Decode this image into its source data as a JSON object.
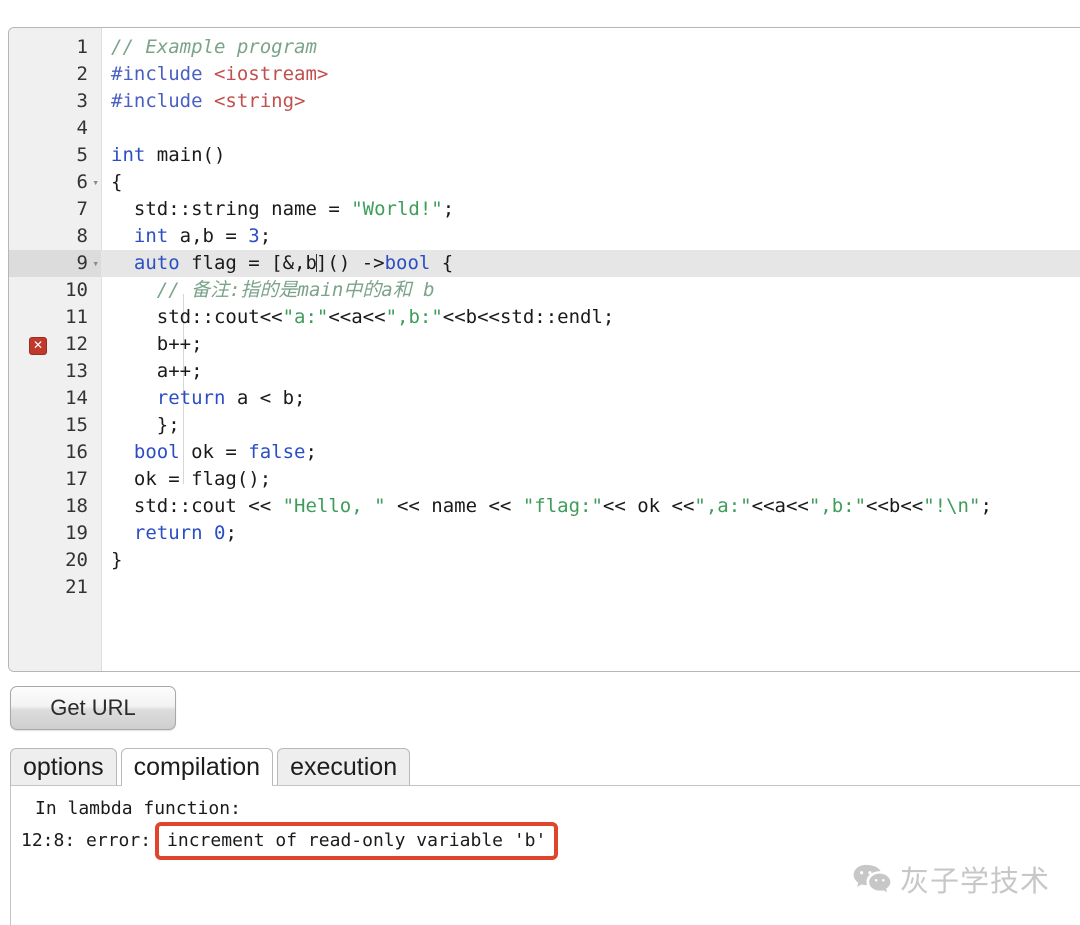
{
  "editor": {
    "name": "cpp-code-editor",
    "active_line": 9,
    "error_line": 12,
    "error_marker_glyph": "✕",
    "fold_lines": [
      6,
      9
    ],
    "colors": {
      "comment": "#7aa38a",
      "preprocessor": "#4a5fc1",
      "header": "#c0504d",
      "keyword": "#2b4ec4",
      "string": "#3f9d5a",
      "plain": "#1a1a1a",
      "gutter_bg": "#f0f0f0",
      "active_line_bg": "#e6e6e6",
      "error_marker": "#c0392b"
    },
    "lines": [
      {
        "n": "1",
        "tokens": [
          {
            "c": "t-com",
            "t": "// Example program"
          }
        ]
      },
      {
        "n": "2",
        "tokens": [
          {
            "c": "t-pre",
            "t": "#include"
          },
          {
            "c": "t-pln",
            "t": " "
          },
          {
            "c": "t-hdr",
            "t": "<iostream>"
          }
        ]
      },
      {
        "n": "3",
        "tokens": [
          {
            "c": "t-pre",
            "t": "#include"
          },
          {
            "c": "t-pln",
            "t": " "
          },
          {
            "c": "t-hdr",
            "t": "<string>"
          }
        ]
      },
      {
        "n": "4",
        "tokens": []
      },
      {
        "n": "5",
        "tokens": [
          {
            "c": "t-kw",
            "t": "int"
          },
          {
            "c": "t-pln",
            "t": " main()"
          }
        ]
      },
      {
        "n": "6",
        "tokens": [
          {
            "c": "t-pln",
            "t": "{"
          }
        ]
      },
      {
        "n": "7",
        "tokens": [
          {
            "c": "t-pln",
            "t": "  std::string name = "
          },
          {
            "c": "t-str",
            "t": "\"World!\""
          },
          {
            "c": "t-pln",
            "t": ";"
          }
        ]
      },
      {
        "n": "8",
        "tokens": [
          {
            "c": "t-pln",
            "t": "  "
          },
          {
            "c": "t-kw",
            "t": "int"
          },
          {
            "c": "t-pln",
            "t": " a,b = "
          },
          {
            "c": "t-num",
            "t": "3"
          },
          {
            "c": "t-pln",
            "t": ";"
          }
        ]
      },
      {
        "n": "9",
        "tokens": [
          {
            "c": "t-pln",
            "t": "  "
          },
          {
            "c": "t-kw",
            "t": "auto"
          },
          {
            "c": "t-pln",
            "t": " flag = [&,b]() ->"
          },
          {
            "c": "t-kw",
            "t": "bool"
          },
          {
            "c": "t-pln",
            "t": " {"
          }
        ]
      },
      {
        "n": "10",
        "tokens": [
          {
            "c": "t-pln",
            "t": "    "
          },
          {
            "c": "t-com",
            "t": "// 备注:指的是main中的a和 b"
          }
        ]
      },
      {
        "n": "11",
        "tokens": [
          {
            "c": "t-pln",
            "t": "    std::cout<<"
          },
          {
            "c": "t-str",
            "t": "\"a:\""
          },
          {
            "c": "t-pln",
            "t": "<<a<<"
          },
          {
            "c": "t-str",
            "t": "\",b:\""
          },
          {
            "c": "t-pln",
            "t": "<<b<<std::endl;"
          }
        ]
      },
      {
        "n": "12",
        "tokens": [
          {
            "c": "t-pln",
            "t": "    b++;"
          }
        ]
      },
      {
        "n": "13",
        "tokens": [
          {
            "c": "t-pln",
            "t": "    a++;"
          }
        ]
      },
      {
        "n": "14",
        "tokens": [
          {
            "c": "t-pln",
            "t": "    "
          },
          {
            "c": "t-kw",
            "t": "return"
          },
          {
            "c": "t-pln",
            "t": " a < b;"
          }
        ]
      },
      {
        "n": "15",
        "tokens": [
          {
            "c": "t-pln",
            "t": "    };"
          }
        ]
      },
      {
        "n": "16",
        "tokens": [
          {
            "c": "t-pln",
            "t": "  "
          },
          {
            "c": "t-kw",
            "t": "bool"
          },
          {
            "c": "t-pln",
            "t": " ok = "
          },
          {
            "c": "t-kw",
            "t": "false"
          },
          {
            "c": "t-pln",
            "t": ";"
          }
        ]
      },
      {
        "n": "17",
        "tokens": [
          {
            "c": "t-pln",
            "t": "  ok = flag();"
          }
        ]
      },
      {
        "n": "18",
        "tokens": [
          {
            "c": "t-pln",
            "t": "  std::cout << "
          },
          {
            "c": "t-str",
            "t": "\"Hello, \""
          },
          {
            "c": "t-pln",
            "t": " << name << "
          },
          {
            "c": "t-str",
            "t": "\"flag:\""
          },
          {
            "c": "t-pln",
            "t": "<< ok <<"
          },
          {
            "c": "t-str",
            "t": "\",a:\""
          },
          {
            "c": "t-pln",
            "t": "<<a<<"
          },
          {
            "c": "t-str",
            "t": "\",b:\""
          },
          {
            "c": "t-pln",
            "t": "<<b<<"
          },
          {
            "c": "t-str",
            "t": "\"!\\n\""
          },
          {
            "c": "t-pln",
            "t": ";"
          }
        ]
      },
      {
        "n": "19",
        "tokens": [
          {
            "c": "t-pln",
            "t": "  "
          },
          {
            "c": "t-kw",
            "t": "return"
          },
          {
            "c": "t-pln",
            "t": " "
          },
          {
            "c": "t-num",
            "t": "0"
          },
          {
            "c": "t-pln",
            "t": ";"
          }
        ]
      },
      {
        "n": "20",
        "tokens": [
          {
            "c": "t-pln",
            "t": "}"
          }
        ]
      },
      {
        "n": "21",
        "tokens": []
      }
    ]
  },
  "toolbar": {
    "get_url_label": "Get URL"
  },
  "tabs": {
    "items": [
      {
        "label": "options",
        "active": false
      },
      {
        "label": "compilation",
        "active": true
      },
      {
        "label": "execution",
        "active": false
      }
    ]
  },
  "output": {
    "line1": "In lambda function:",
    "error_prefix": "12:8: error:",
    "error_message": "increment of read-only variable 'b'",
    "highlight_color": "#e0452b"
  },
  "watermark": {
    "icon": "wechat-icon",
    "text": "灰子学技术"
  }
}
